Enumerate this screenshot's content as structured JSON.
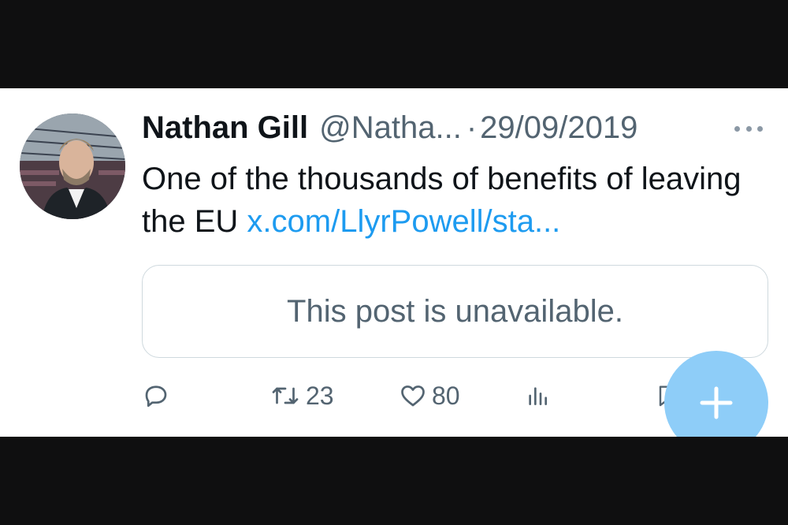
{
  "tweet": {
    "author_name": "Nathan Gill",
    "author_handle": "@Natha...",
    "separator": "·",
    "date": "29/09/2019",
    "text_prefix": "One of the thousands of benefits of leaving the EU ",
    "link_text": "x.com/LlyrPowell/sta...",
    "quoted_post_notice": "This post is unavailable."
  },
  "actions": {
    "reply_icon": "reply-icon",
    "repost_icon": "repost-icon",
    "repost_count": "23",
    "like_icon": "heart-icon",
    "like_count": "80",
    "views_icon": "views-icon",
    "bookmark_icon": "bookmark-icon",
    "share_icon": "share-icon"
  },
  "fab": {
    "icon": "plus-icon"
  },
  "colors": {
    "link": "#1d9bf0",
    "secondary_text": "#536471",
    "primary_text": "#0f1419",
    "fab": "#8ecdf8",
    "border": "#cfd9de"
  }
}
